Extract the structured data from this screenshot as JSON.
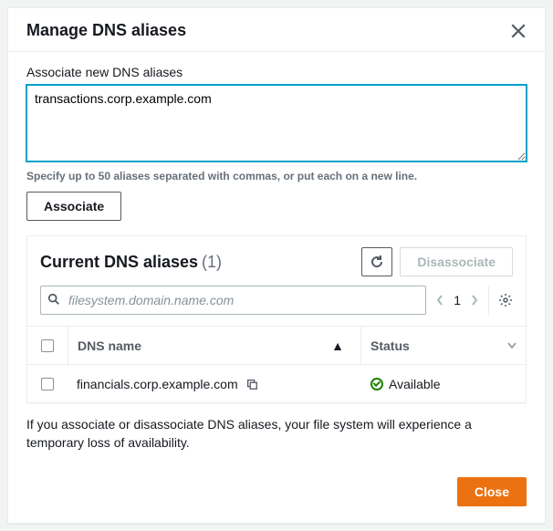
{
  "dialog": {
    "title": "Manage DNS aliases",
    "close_label": "Close",
    "notice": "If you associate or disassociate DNS aliases, your file system will experience a temporary loss of availability."
  },
  "associate": {
    "label": "Associate new DNS aliases",
    "value": "transactions.corp.example.com",
    "help": "Specify up to 50 aliases separated with commas, or put each on a new line.",
    "button": "Associate"
  },
  "table": {
    "title": "Current DNS aliases",
    "count": "(1)",
    "refresh_label": "Refresh",
    "disassociate_label": "Disassociate",
    "search_placeholder": "filesystem.domain.name.com",
    "page": "1",
    "columns": {
      "name": "DNS name",
      "status": "Status"
    },
    "rows": [
      {
        "name": "financials.corp.example.com",
        "status": "Available"
      }
    ]
  }
}
